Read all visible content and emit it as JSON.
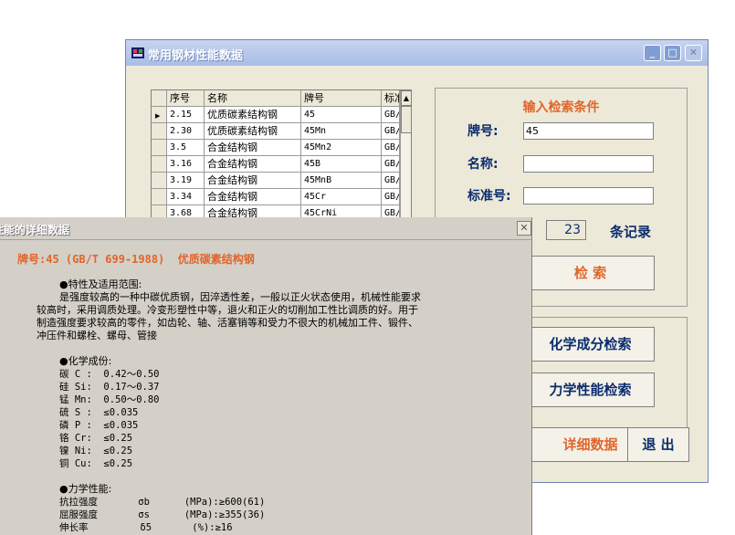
{
  "main_window": {
    "title": "常用钢材性能数据",
    "caption_buttons": {
      "minimize": "_",
      "maximize": "□",
      "close": "✕"
    }
  },
  "table": {
    "columns": [
      "序号",
      "名称",
      "牌号",
      "标准"
    ],
    "rows": [
      {
        "no": "2.15",
        "name": "优质碳素结构钢",
        "grade": "45",
        "std": "GB/"
      },
      {
        "no": "2.30",
        "name": "优质碳素结构钢",
        "grade": "45Mn",
        "std": "GB/"
      },
      {
        "no": "3.5",
        "name": "合金结构钢",
        "grade": "45Mn2",
        "std": "GB/"
      },
      {
        "no": "3.16",
        "name": "合金结构钢",
        "grade": "45B",
        "std": "GB/"
      },
      {
        "no": "3.19",
        "name": "合金结构钢",
        "grade": "45MnB",
        "std": "GB/"
      },
      {
        "no": "3.34",
        "name": "合金结构钢",
        "grade": "45Cr",
        "std": "GB/"
      },
      {
        "no": "3.68",
        "name": "合金结构钢",
        "grade": "45CrNi",
        "std": "GB/"
      }
    ],
    "current_row_marker": "▶",
    "scroll_up": "▲"
  },
  "search": {
    "heading": "输入检索条件",
    "grade_label": "牌号:",
    "grade_value": "45",
    "name_label": "名称:",
    "name_value": "",
    "standard_label": "标准号:",
    "standard_value": "",
    "count": "23",
    "count_label": "条记录",
    "search_button": "检 索",
    "chem_button": "化学成分检索",
    "mech_button": "力学性能检索",
    "detail_button": "详细数据",
    "exit_button": "退 出"
  },
  "detail": {
    "title": "性能的详细数据",
    "close": "✕",
    "heading": "牌号:45 (GB/T 699-1988)  优质碳素结构钢",
    "usage_title": "●特性及适用范围:",
    "usage_lines": [
      "是强度较高的一种中碳优质钢，因淬透性差，一般以正火状态使用，机械性能要求",
      "较高时，采用调质处理。冷变形塑性中等，退火和正火的切削加工性比调质的好。用于",
      "制造强度要求较高的零件，如齿轮、轴、活塞销等和受力不很大的机械加工件、锻件、",
      "冲压件和螺栓、螺母、管接"
    ],
    "chem_title": "●化学成份:",
    "chem_lines": [
      "碳 C :  0.42～0.50",
      "硅 Si:  0.17～0.37",
      "锰 Mn:  0.50～0.80",
      "硫 S :  ≤0.035",
      "磷 P :  ≤0.035",
      "铬 Cr:  ≤0.25",
      "镍 Ni:  ≤0.25",
      "铜 Cu:  ≤0.25"
    ],
    "mech_title": "●力学性能:",
    "mech_lines": [
      "抗拉强度       σb      (MPa):≥600(61)",
      "屈服强度       σs      (MPa):≥355(36)",
      "伸长率         δ5       (%):≥16"
    ]
  }
}
